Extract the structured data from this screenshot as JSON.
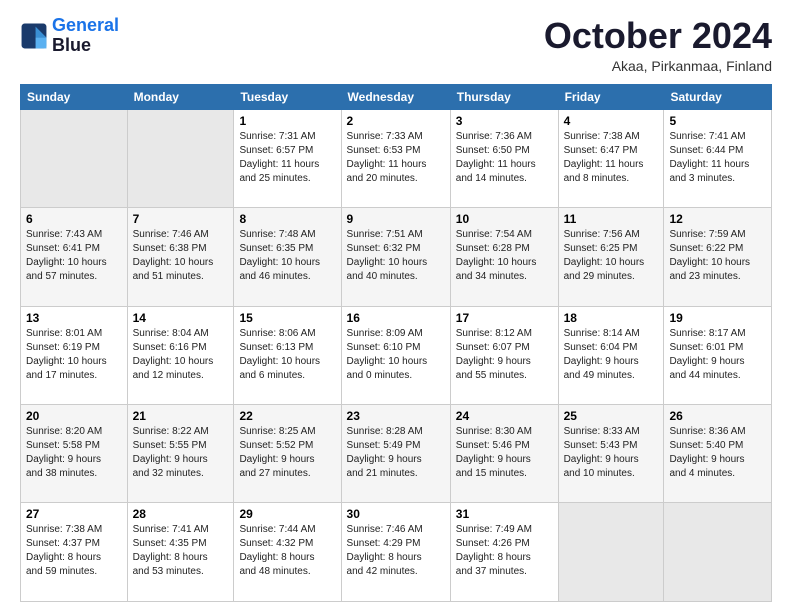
{
  "logo": {
    "line1": "General",
    "line2": "Blue"
  },
  "title": "October 2024",
  "subtitle": "Akaa, Pirkanmaa, Finland",
  "days_header": [
    "Sunday",
    "Monday",
    "Tuesday",
    "Wednesday",
    "Thursday",
    "Friday",
    "Saturday"
  ],
  "weeks": [
    [
      {
        "day": "",
        "info": ""
      },
      {
        "day": "",
        "info": ""
      },
      {
        "day": "1",
        "info": "Sunrise: 7:31 AM\nSunset: 6:57 PM\nDaylight: 11 hours\nand 25 minutes."
      },
      {
        "day": "2",
        "info": "Sunrise: 7:33 AM\nSunset: 6:53 PM\nDaylight: 11 hours\nand 20 minutes."
      },
      {
        "day": "3",
        "info": "Sunrise: 7:36 AM\nSunset: 6:50 PM\nDaylight: 11 hours\nand 14 minutes."
      },
      {
        "day": "4",
        "info": "Sunrise: 7:38 AM\nSunset: 6:47 PM\nDaylight: 11 hours\nand 8 minutes."
      },
      {
        "day": "5",
        "info": "Sunrise: 7:41 AM\nSunset: 6:44 PM\nDaylight: 11 hours\nand 3 minutes."
      }
    ],
    [
      {
        "day": "6",
        "info": "Sunrise: 7:43 AM\nSunset: 6:41 PM\nDaylight: 10 hours\nand 57 minutes."
      },
      {
        "day": "7",
        "info": "Sunrise: 7:46 AM\nSunset: 6:38 PM\nDaylight: 10 hours\nand 51 minutes."
      },
      {
        "day": "8",
        "info": "Sunrise: 7:48 AM\nSunset: 6:35 PM\nDaylight: 10 hours\nand 46 minutes."
      },
      {
        "day": "9",
        "info": "Sunrise: 7:51 AM\nSunset: 6:32 PM\nDaylight: 10 hours\nand 40 minutes."
      },
      {
        "day": "10",
        "info": "Sunrise: 7:54 AM\nSunset: 6:28 PM\nDaylight: 10 hours\nand 34 minutes."
      },
      {
        "day": "11",
        "info": "Sunrise: 7:56 AM\nSunset: 6:25 PM\nDaylight: 10 hours\nand 29 minutes."
      },
      {
        "day": "12",
        "info": "Sunrise: 7:59 AM\nSunset: 6:22 PM\nDaylight: 10 hours\nand 23 minutes."
      }
    ],
    [
      {
        "day": "13",
        "info": "Sunrise: 8:01 AM\nSunset: 6:19 PM\nDaylight: 10 hours\nand 17 minutes."
      },
      {
        "day": "14",
        "info": "Sunrise: 8:04 AM\nSunset: 6:16 PM\nDaylight: 10 hours\nand 12 minutes."
      },
      {
        "day": "15",
        "info": "Sunrise: 8:06 AM\nSunset: 6:13 PM\nDaylight: 10 hours\nand 6 minutes."
      },
      {
        "day": "16",
        "info": "Sunrise: 8:09 AM\nSunset: 6:10 PM\nDaylight: 10 hours\nand 0 minutes."
      },
      {
        "day": "17",
        "info": "Sunrise: 8:12 AM\nSunset: 6:07 PM\nDaylight: 9 hours\nand 55 minutes."
      },
      {
        "day": "18",
        "info": "Sunrise: 8:14 AM\nSunset: 6:04 PM\nDaylight: 9 hours\nand 49 minutes."
      },
      {
        "day": "19",
        "info": "Sunrise: 8:17 AM\nSunset: 6:01 PM\nDaylight: 9 hours\nand 44 minutes."
      }
    ],
    [
      {
        "day": "20",
        "info": "Sunrise: 8:20 AM\nSunset: 5:58 PM\nDaylight: 9 hours\nand 38 minutes."
      },
      {
        "day": "21",
        "info": "Sunrise: 8:22 AM\nSunset: 5:55 PM\nDaylight: 9 hours\nand 32 minutes."
      },
      {
        "day": "22",
        "info": "Sunrise: 8:25 AM\nSunset: 5:52 PM\nDaylight: 9 hours\nand 27 minutes."
      },
      {
        "day": "23",
        "info": "Sunrise: 8:28 AM\nSunset: 5:49 PM\nDaylight: 9 hours\nand 21 minutes."
      },
      {
        "day": "24",
        "info": "Sunrise: 8:30 AM\nSunset: 5:46 PM\nDaylight: 9 hours\nand 15 minutes."
      },
      {
        "day": "25",
        "info": "Sunrise: 8:33 AM\nSunset: 5:43 PM\nDaylight: 9 hours\nand 10 minutes."
      },
      {
        "day": "26",
        "info": "Sunrise: 8:36 AM\nSunset: 5:40 PM\nDaylight: 9 hours\nand 4 minutes."
      }
    ],
    [
      {
        "day": "27",
        "info": "Sunrise: 7:38 AM\nSunset: 4:37 PM\nDaylight: 8 hours\nand 59 minutes."
      },
      {
        "day": "28",
        "info": "Sunrise: 7:41 AM\nSunset: 4:35 PM\nDaylight: 8 hours\nand 53 minutes."
      },
      {
        "day": "29",
        "info": "Sunrise: 7:44 AM\nSunset: 4:32 PM\nDaylight: 8 hours\nand 48 minutes."
      },
      {
        "day": "30",
        "info": "Sunrise: 7:46 AM\nSunset: 4:29 PM\nDaylight: 8 hours\nand 42 minutes."
      },
      {
        "day": "31",
        "info": "Sunrise: 7:49 AM\nSunset: 4:26 PM\nDaylight: 8 hours\nand 37 minutes."
      },
      {
        "day": "",
        "info": ""
      },
      {
        "day": "",
        "info": ""
      }
    ]
  ]
}
